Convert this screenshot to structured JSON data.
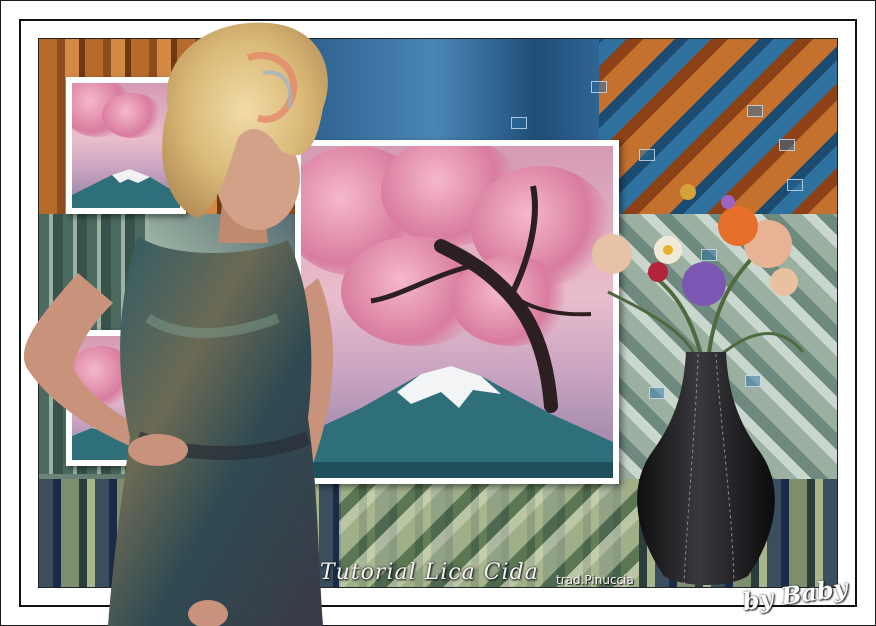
{
  "caption": {
    "title": "Tutorial Lica Cida",
    "translator": "trad.Pinuccia",
    "signature": "by Baby"
  },
  "palette": {
    "frame_outer": "#ffffff",
    "frame_line": "#111111",
    "copper": "#b66b2a",
    "steel_blue": "#2d5f8e",
    "sage": "#8aa38e",
    "navy": "#1d2a48",
    "blossom_pink": "#d97c9f",
    "mountain_teal": "#2f6f7a",
    "vase_black": "#1b1b1d"
  },
  "scene": {
    "subject": "woman-with-curly-blonde-hair",
    "main_picture": "cherry-blossom-tree-and-mount-fuji",
    "bouquet": "flower-bouquet-in-black-vase"
  }
}
